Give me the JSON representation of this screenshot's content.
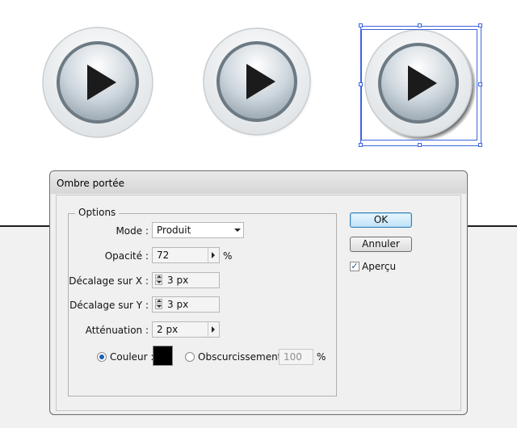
{
  "dialog": {
    "title": "Ombre portée",
    "group_title": "Options",
    "mode": {
      "label": "Mode :",
      "value": "Produit"
    },
    "opacity": {
      "label": "Opacité :",
      "value": "72",
      "unit": "%"
    },
    "offset_x": {
      "label": "Décalage sur X :",
      "value": "3 px"
    },
    "offset_y": {
      "label": "Décalage sur Y :",
      "value": "3 px"
    },
    "blur": {
      "label": "Atténuation :",
      "value": "2 px"
    },
    "color_option": {
      "label": "Couleur :",
      "selected": true,
      "swatch": "#000000"
    },
    "darkness_option": {
      "label": "Obscurcissement :",
      "value": "100",
      "unit": "%",
      "selected": false
    },
    "ok_label": "OK",
    "cancel_label": "Annuler",
    "preview": {
      "label": "Aperçu",
      "checked": true,
      "mark": "✓"
    }
  },
  "canvas": {
    "buttons": [
      {
        "name": "plain-play-button"
      },
      {
        "name": "glow-play-button"
      },
      {
        "name": "shadow-play-button-selected"
      }
    ]
  },
  "colors": {
    "selection": "#3d63e0",
    "default_button": "#bfe3f7",
    "canvas_bottom": "#f1f1f1"
  }
}
